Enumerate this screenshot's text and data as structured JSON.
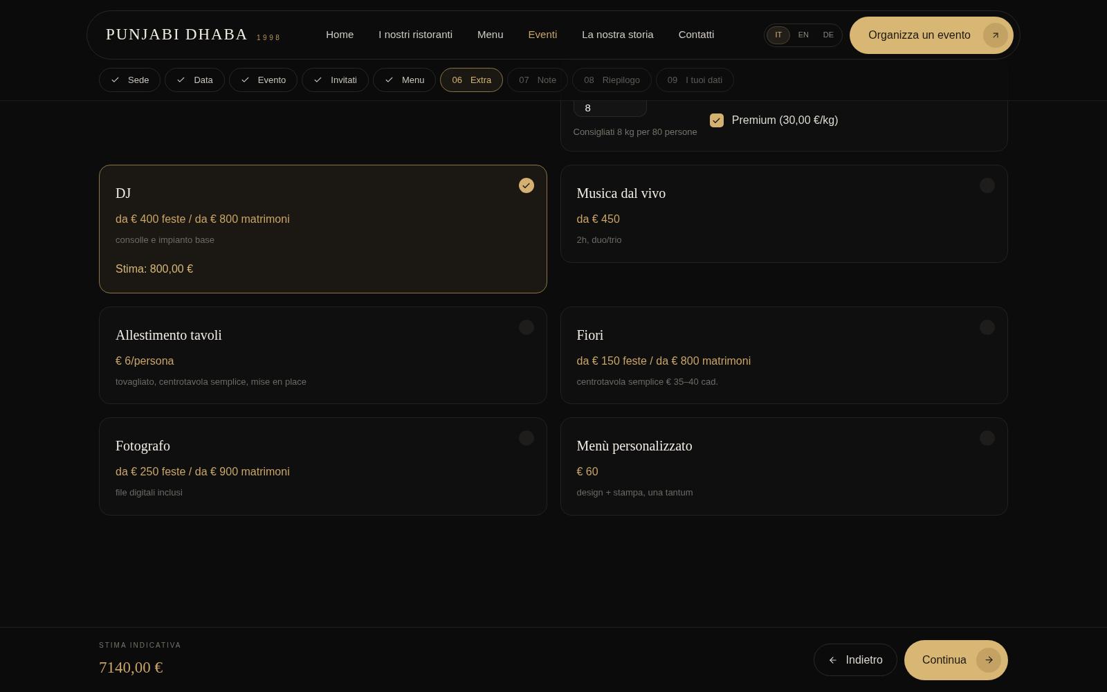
{
  "header": {
    "logo": "PUNJABI DHABA",
    "logo_year": "1998",
    "nav": [
      {
        "label": "Home",
        "selected": false
      },
      {
        "label": "I nostri ristoranti",
        "selected": false
      },
      {
        "label": "Menu",
        "selected": false
      },
      {
        "label": "Eventi",
        "selected": true
      },
      {
        "label": "La nostra storia",
        "selected": false
      },
      {
        "label": "Contatti",
        "selected": false
      }
    ],
    "languages": [
      {
        "label": "IT",
        "selected": true
      },
      {
        "label": "EN",
        "selected": false
      },
      {
        "label": "DE",
        "selected": false
      }
    ],
    "cta": "Organizza un evento"
  },
  "steps": [
    {
      "label": "Sede",
      "kind": "done"
    },
    {
      "label": "Data",
      "kind": "done"
    },
    {
      "label": "Evento",
      "kind": "done"
    },
    {
      "label": "Invitati",
      "kind": "done"
    },
    {
      "label": "Menu",
      "kind": "done"
    },
    {
      "number": "06",
      "label": "Extra",
      "kind": "current"
    },
    {
      "number": "07",
      "label": "Note",
      "kind": "upcoming"
    },
    {
      "number": "08",
      "label": "Riepilogo",
      "kind": "upcoming"
    },
    {
      "number": "09",
      "label": "I tuoi dati",
      "kind": "upcoming"
    }
  ],
  "quantity_card": {
    "value": "8",
    "hint": "Consigliati 8 kg per 80 persone",
    "premium": {
      "label": "Premium (30,00 €/kg)",
      "checked": true
    }
  },
  "extras": [
    {
      "title": "DJ",
      "price": "da € 400 feste / da € 800 matrimoni",
      "note": "consolle e impianto base",
      "estimate": "Stima: 800,00 €",
      "selected": true
    },
    {
      "title": "Musica dal vivo",
      "price": "da € 450",
      "note": "2h, duo/trio",
      "selected": false
    },
    {
      "title": "Allestimento tavoli",
      "price": "€ 6/persona",
      "note": "tovagliato, centrotavola semplice, mise en place",
      "selected": false
    },
    {
      "title": "Fiori",
      "price": "da € 150 feste / da € 800 matrimoni",
      "note": "centrotavola semplice € 35–40 cad.",
      "selected": false
    },
    {
      "title": "Fotografo",
      "price": "da € 250 feste / da € 900 matrimoni",
      "note": "file digitali inclusi",
      "selected": false
    },
    {
      "title": "Menù personalizzato",
      "price": "€ 60",
      "note": "design + stampa, una tantum",
      "selected": false
    }
  ],
  "footer": {
    "label": "STIMA INDICATIVA",
    "total": "7140,00 €",
    "back": "Indietro",
    "next": "Continua"
  }
}
